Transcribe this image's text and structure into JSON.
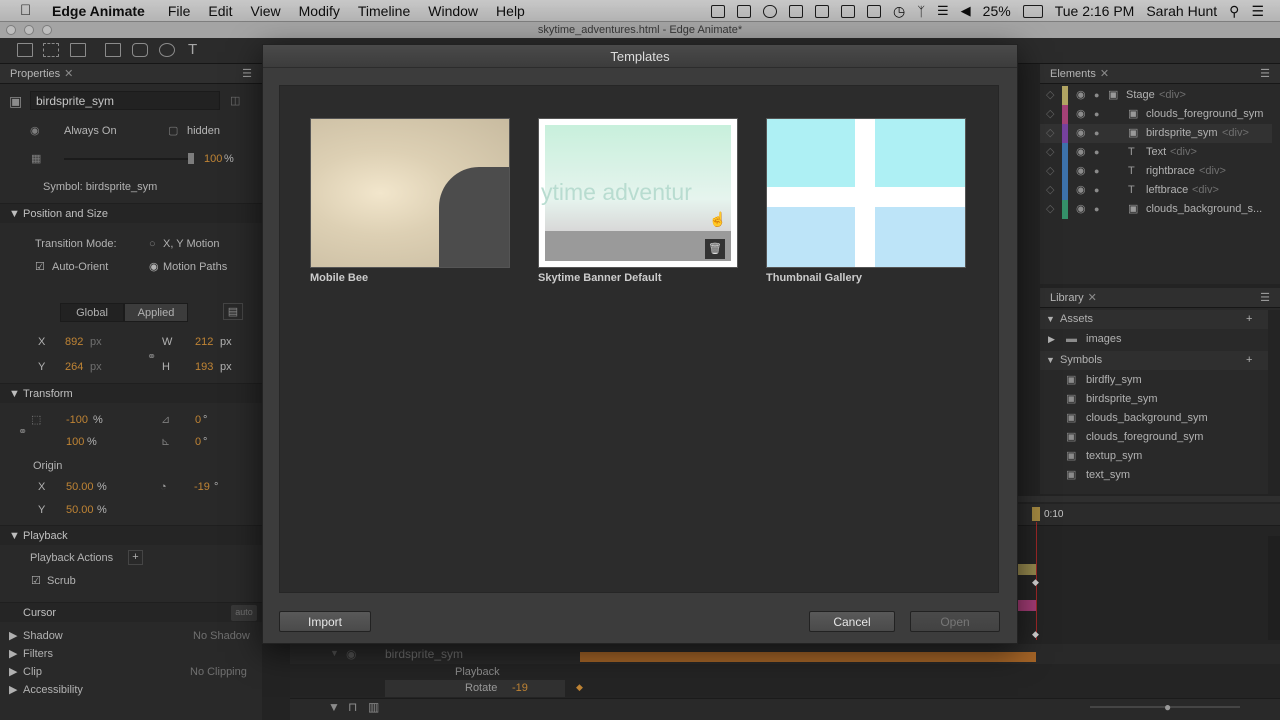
{
  "menubar": {
    "app_name": "Edge Animate",
    "menus": [
      "File",
      "Edit",
      "View",
      "Modify",
      "Timeline",
      "Window",
      "Help"
    ],
    "battery": "25%",
    "clock": "Tue 2:16 PM",
    "user": "Sarah Hunt"
  },
  "window": {
    "title": "skytime_adventures.html - Edge Animate*"
  },
  "properties": {
    "tab": "Properties",
    "symbol_name": "birdsprite_sym",
    "display": "Always On",
    "overflow": "hidden",
    "opacity": "100",
    "opacity_unit": "%",
    "symbol_label": "Symbol: birdsprite_sym",
    "position_section": "Position and Size",
    "transition_mode_label": "Transition Mode:",
    "xy_motion": "X, Y Motion",
    "auto_orient": "Auto-Orient",
    "motion_paths": "Motion Paths",
    "global": "Global",
    "applied": "Applied",
    "x_label": "X",
    "x_value": "892",
    "px": "px",
    "y_label": "Y",
    "y_value": "264",
    "w_label": "W",
    "w_value": "212",
    "h_label": "H",
    "h_value": "193",
    "transform_section": "Transform",
    "scale_x": "-100",
    "scale_y": "100",
    "pct": "%",
    "skew_x": "0",
    "skew_y": "0",
    "deg": "°",
    "origin_label": "Origin",
    "origin_x": "50.00",
    "origin_y": "50.00",
    "rotate": "-19",
    "playback_section": "Playback",
    "playback_actions": "Playback Actions",
    "scrub": "Scrub",
    "cursor": "Cursor",
    "cursor_value": "auto",
    "shadow": "Shadow",
    "shadow_value": "No Shadow",
    "filters": "Filters",
    "clip": "Clip",
    "clip_value": "No Clipping",
    "accessibility": "Accessibility"
  },
  "elements": {
    "tab": "Elements",
    "items": [
      {
        "name": "Stage",
        "tag": "<div>",
        "color": "#d8c878"
      },
      {
        "name": "clouds_foreground_sym",
        "tag": "",
        "color": "#c85090"
      },
      {
        "name": "birdsprite_sym",
        "tag": "<div>",
        "color": "#9050c0"
      },
      {
        "name": "Text",
        "tag": "<div>",
        "color": "#4a8ad0"
      },
      {
        "name": "rightbrace",
        "tag": "<div>",
        "color": "#4a8ad0"
      },
      {
        "name": "leftbrace",
        "tag": "<div>",
        "color": "#4a8ad0"
      },
      {
        "name": "clouds_background_s...",
        "tag": "",
        "color": "#40b080"
      }
    ]
  },
  "library": {
    "tab": "Library",
    "assets": "Assets",
    "images": "images",
    "symbols": "Symbols",
    "symbol_items": [
      "birdfly_sym",
      "birdsprite_sym",
      "clouds_background_sym",
      "clouds_foreground_sym",
      "textup_sym",
      "text_sym"
    ]
  },
  "timeline": {
    "time": "0:10",
    "layer": "birdsprite_sym",
    "playback": "Playback",
    "rotate_label": "Rotate",
    "rotate_value": "-19"
  },
  "dialog": {
    "title": "Templates",
    "templates": [
      {
        "label": "Mobile Bee"
      },
      {
        "label": "Skytime Banner Default",
        "text": "ytime adventur"
      },
      {
        "label": "Thumbnail Gallery"
      }
    ],
    "import": "Import",
    "cancel": "Cancel",
    "open": "Open"
  },
  "colors": {
    "accent": "#e8a040",
    "timeline_bar": "#c87a30"
  }
}
